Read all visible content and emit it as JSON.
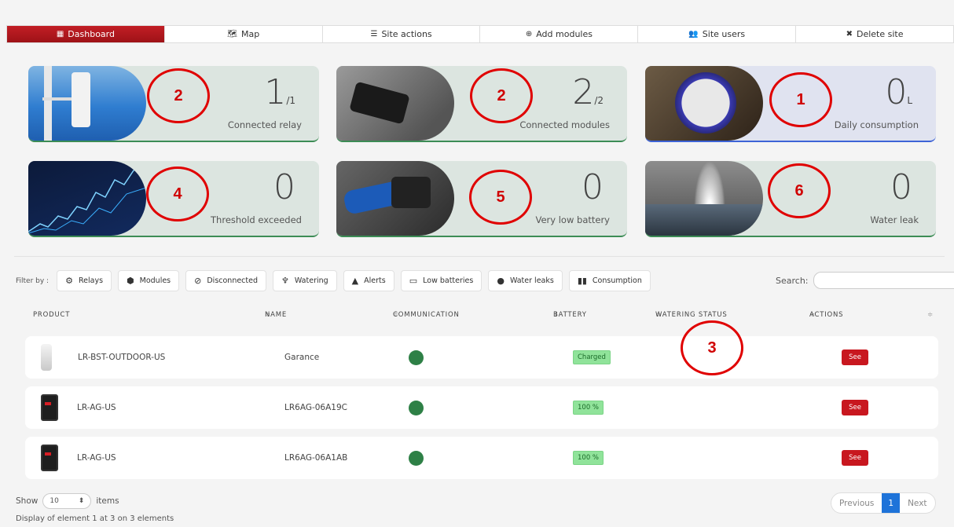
{
  "tabs": [
    {
      "label": "Dashboard",
      "icon": "▦"
    },
    {
      "label": "Map",
      "icon": "🗺"
    },
    {
      "label": "Site actions",
      "icon": "☰"
    },
    {
      "label": "Add modules",
      "icon": "⊕"
    },
    {
      "label": "Site users",
      "icon": "👥"
    },
    {
      "label": "Delete site",
      "icon": "✖"
    }
  ],
  "cards": [
    {
      "value": "1",
      "suffix": "/1",
      "label": "Connected relay",
      "callout": "2"
    },
    {
      "value": "2",
      "suffix": "/2",
      "label": "Connected modules",
      "callout": "2"
    },
    {
      "value": "0",
      "suffix": "L",
      "label": "Daily consumption",
      "callout": "1"
    },
    {
      "value": "0",
      "suffix": "",
      "label": "Threshold exceeded",
      "callout": "4"
    },
    {
      "value": "0",
      "suffix": "",
      "label": "Very low battery",
      "callout": "5"
    },
    {
      "value": "0",
      "suffix": "",
      "label": "Water leak",
      "callout": "6"
    }
  ],
  "filters": {
    "label": "Filter by :",
    "buttons": [
      "Relays",
      "Modules",
      "Disconnected",
      "Watering",
      "Alerts",
      "Low batteries",
      "Water leaks",
      "Consumption"
    ]
  },
  "search": {
    "label": "Search:",
    "placeholder": ""
  },
  "table": {
    "headers": [
      "PRODUCT",
      "NAME",
      "COMMUNICATION",
      "BATTERY",
      "WATERING STATUS",
      "ACTIONS"
    ],
    "callout": "3",
    "rows": [
      {
        "product": "LR-BST-OUTDOOR-US",
        "name": "Garance",
        "battery": "Charged",
        "watering": "",
        "action": "See"
      },
      {
        "product": "LR-AG-US",
        "name": "LR6AG-06A19C",
        "battery": "100 %",
        "watering": "",
        "action": "See"
      },
      {
        "product": "LR-AG-US",
        "name": "LR6AG-06A1AB",
        "battery": "100 %",
        "watering": "",
        "action": "See"
      }
    ]
  },
  "footer": {
    "show_label": "Show",
    "page_size": "10",
    "items_label": "items",
    "display_info": "Display of element 1 at 3 on 3 elements",
    "pager": {
      "previous": "Previous",
      "current": "1",
      "next": "Next"
    }
  },
  "colors": {
    "accent": "#c21e25",
    "green": "#2e8046",
    "blue": "#1e73d9",
    "callout": "#e00000"
  }
}
